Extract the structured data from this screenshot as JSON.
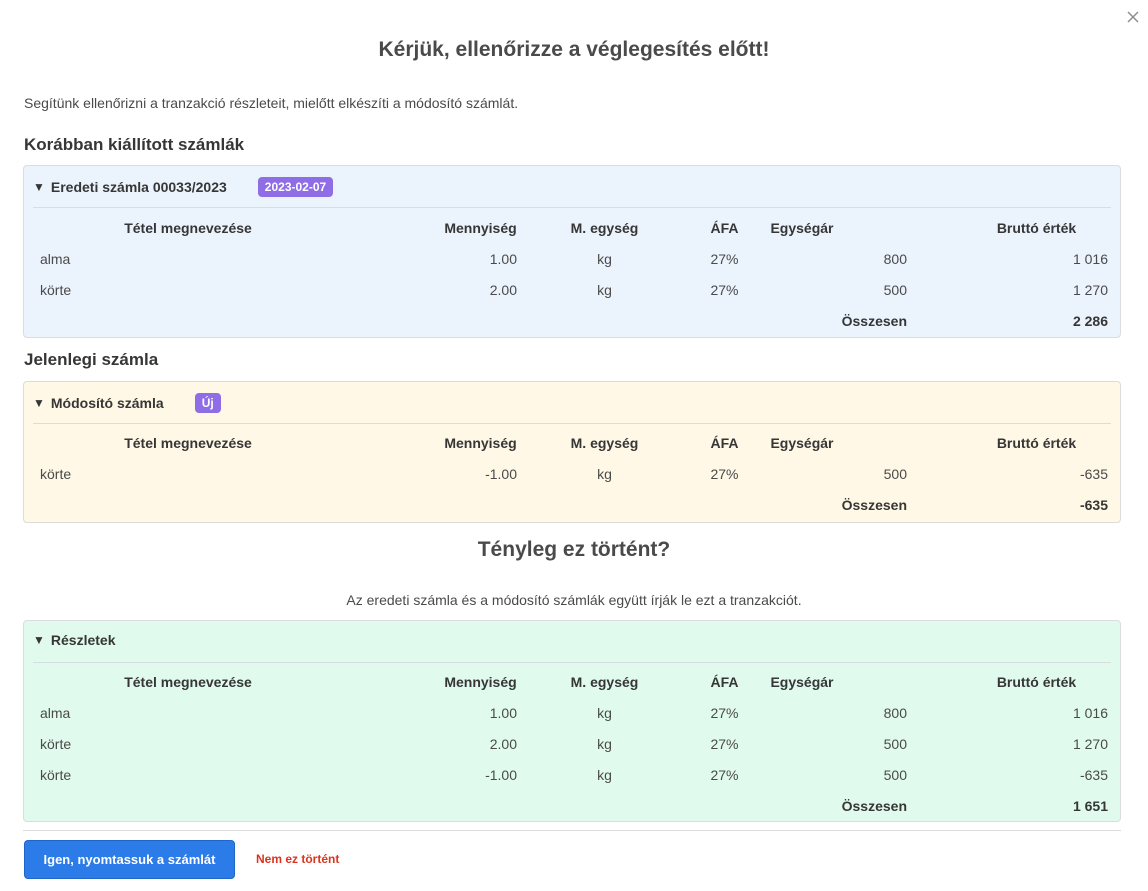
{
  "dialog": {
    "title": "Kérjük, ellenőrizze a véglegesítés előtt!",
    "intro": "Segítünk ellenőrizni a tranzakció részleteit, mielőtt elkészíti a módosító számlát."
  },
  "columns": [
    "Tétel megnevezése",
    "Mennyiség",
    "M. egység",
    "ÁFA",
    "Egységár",
    "Bruttó érték"
  ],
  "previous": {
    "section_title": "Korábban kiállított számlák",
    "panel_title": "Eredeti számla 00033/2023",
    "badge": "2023-02-07",
    "rows": [
      {
        "name": "alma",
        "qty": "1.00",
        "unit": "kg",
        "vat": "27%",
        "price": "800",
        "gross": "1 016"
      },
      {
        "name": "körte",
        "qty": "2.00",
        "unit": "kg",
        "vat": "27%",
        "price": "500",
        "gross": "1 270"
      }
    ],
    "total_label": "Összesen",
    "total": "2 286"
  },
  "current": {
    "section_title": "Jelenlegi számla",
    "panel_title": "Módosító számla",
    "badge": "Új",
    "rows": [
      {
        "name": "körte",
        "qty": "-1.00",
        "unit": "kg",
        "vat": "27%",
        "price": "500",
        "gross": "-635"
      }
    ],
    "total_label": "Összesen",
    "total": "-635"
  },
  "question": {
    "title": "Tényleg ez történt?",
    "subtitle": "Az eredeti számla és a módosító számlák együtt írják le ezt a tranzakciót."
  },
  "details": {
    "panel_title": "Részletek",
    "rows": [
      {
        "name": "alma",
        "qty": "1.00",
        "unit": "kg",
        "vat": "27%",
        "price": "800",
        "gross": "1 016"
      },
      {
        "name": "körte",
        "qty": "2.00",
        "unit": "kg",
        "vat": "27%",
        "price": "500",
        "gross": "1 270"
      },
      {
        "name": "körte",
        "qty": "-1.00",
        "unit": "kg",
        "vat": "27%",
        "price": "500",
        "gross": "-635"
      }
    ],
    "total_label": "Összesen",
    "total": "1 651"
  },
  "actions": {
    "confirm_label": "Igen, nyomtassuk a számlát",
    "reject_label": "Nem ez történt"
  },
  "icons": {
    "close": "close-icon",
    "toggle": "caret-down-icon"
  },
  "colors": {
    "primary": "#2b7be8",
    "danger": "#d9341f",
    "badge": "#8e6de6",
    "panel_previous": "#ebf3fd",
    "panel_current": "#fff8e6",
    "panel_details": "#e0fbee"
  }
}
